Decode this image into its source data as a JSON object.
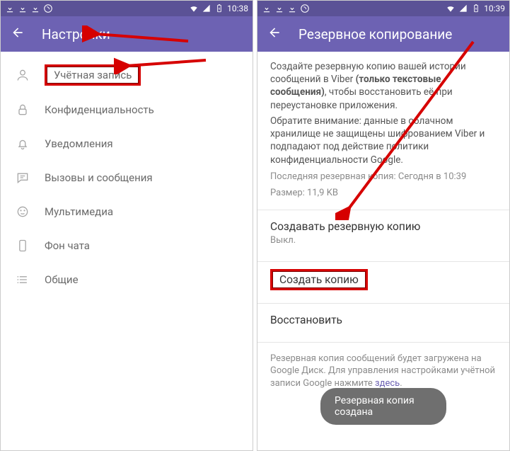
{
  "statusbar": {
    "time": "10:38"
  },
  "statusbar_right": {
    "time": "10:39"
  },
  "left": {
    "title": "Настройки",
    "items": [
      {
        "label": "Учётная запись"
      },
      {
        "label": "Конфиденциальность"
      },
      {
        "label": "Уведомления"
      },
      {
        "label": "Вызовы и сообщения"
      },
      {
        "label": "Мультимедиа"
      },
      {
        "label": "Фон чата"
      },
      {
        "label": "Общие"
      }
    ]
  },
  "right": {
    "title": "Резервное копирование",
    "desc1a": "Создайте резервную копию вашей истории сообщений в Viber ",
    "desc1b": "(только текстовые сообщения)",
    "desc1c": ", чтобы восстановить её при переустановке приложения.",
    "desc2": "Обратите внимание: данные в облачном хранилище не защищены шифрованием Viber и подпадают под действие политики конфиденциальности Google.",
    "last_backup": "Последняя резервная копия: Сегодня в 10:39",
    "size": "Размер: 11,9 KB",
    "auto_title": "Создавать резервную копию",
    "auto_value": "Выкл.",
    "create_now": "Создать копию",
    "restore": "Восстановить",
    "footer_a": "Резервная копия сообщений будет загружена на Google Диск. Для управления настройками учётной записи Google нажмите ",
    "footer_link": "здесь",
    "footer_b": ".",
    "toast": "Резервная копия создана"
  }
}
